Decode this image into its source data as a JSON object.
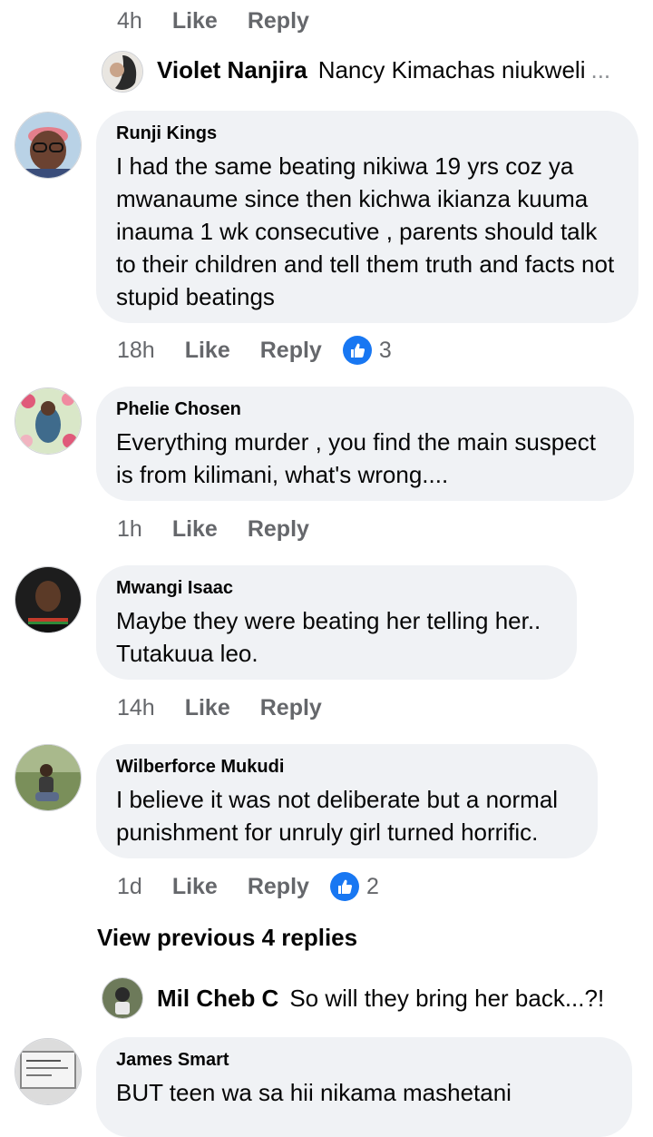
{
  "top_actions": {
    "time": "4h",
    "like": "Like",
    "reply": "Reply"
  },
  "reply_violet": {
    "name": "Violet Nanjira",
    "text": "Nancy Kimachas niukweli",
    "ellipsis": "..."
  },
  "comments": [
    {
      "author": "Runji Kings",
      "text": "I had the same beating nikiwa 19 yrs coz ya mwanaume since  then kichwa ikianza kuuma inauma 1 wk consecutive , parents should talk to their children and tell them truth and facts not stupid beatings",
      "time": "18h",
      "like": "Like",
      "reply": "Reply",
      "reactions": "3"
    },
    {
      "author": "Phelie Chosen",
      "text": "Everything murder , you find the main suspect is from kilimani, what's wrong....",
      "time": "1h",
      "like": "Like",
      "reply": "Reply"
    },
    {
      "author": "Mwangi Isaac",
      "text": "Maybe they were beating her telling her.. Tutakuua leo.",
      "time": "14h",
      "like": "Like",
      "reply": "Reply"
    },
    {
      "author": "Wilberforce Mukudi",
      "text": "I believe it was not deliberate but a normal punishment for unruly girl turned horrific.",
      "time": "1d",
      "like": "Like",
      "reply": "Reply",
      "reactions": "2"
    },
    {
      "author": "James Smart",
      "text": "BUT teen wa  sa hii nikama mashetani"
    }
  ],
  "view_previous": "View previous 4 replies",
  "reply_mil": {
    "name": "Mil Cheb C",
    "text": "So will they bring her back...?!"
  },
  "colors": {
    "bubble": "#f0f2f5",
    "like_blue": "#1877f2",
    "muted": "#65676b"
  }
}
